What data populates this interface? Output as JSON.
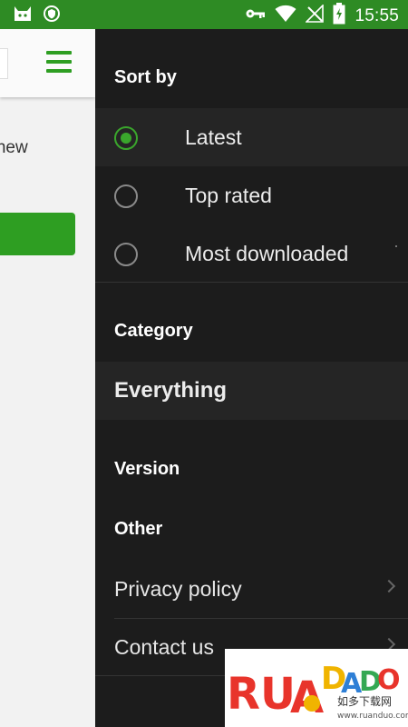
{
  "status_bar": {
    "time": "15:55",
    "icons": [
      "cat-icon",
      "shield-icon",
      "key-icon",
      "wifi-icon",
      "no-signal-icon",
      "battery-charging-icon"
    ]
  },
  "background_app": {
    "partial_text": "g new",
    "menu_icon": "hamburger-menu-icon",
    "accent_color": "#2e9e22"
  },
  "drawer": {
    "sort_by": {
      "title": "Sort by",
      "options": [
        {
          "label": "Latest",
          "selected": true
        },
        {
          "label": "Top rated",
          "selected": false
        },
        {
          "label": "Most downloaded",
          "selected": false
        }
      ]
    },
    "category": {
      "title": "Category",
      "selected": "Everything"
    },
    "version": {
      "title": "Version"
    },
    "other": {
      "title": "Other",
      "links": [
        {
          "label": "Privacy policy"
        },
        {
          "label": "Contact us"
        }
      ]
    },
    "colors": {
      "background": "#1c1c1c",
      "row_highlight": "#252525",
      "accent": "#3aa62c"
    }
  },
  "watermark": {
    "brand": "RUANDUO",
    "subtitle": "如多下载网",
    "url": "www.ruanduo.com"
  }
}
